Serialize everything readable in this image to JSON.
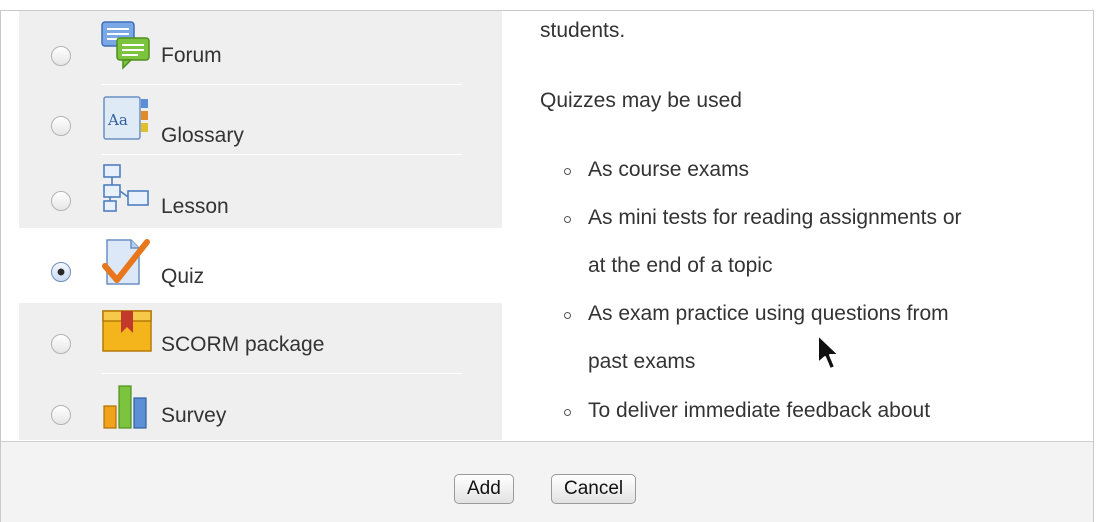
{
  "activities": [
    {
      "label": "Forum",
      "icon": "forum-icon",
      "selected": false
    },
    {
      "label": "Glossary",
      "icon": "glossary-icon",
      "selected": false
    },
    {
      "label": "Lesson",
      "icon": "lesson-icon",
      "selected": false
    },
    {
      "label": "Quiz",
      "icon": "quiz-icon",
      "selected": true
    },
    {
      "label": "SCORM package",
      "icon": "scorm-package-icon",
      "selected": false
    },
    {
      "label": "Survey",
      "icon": "survey-icon",
      "selected": false
    }
  ],
  "description": {
    "top_fragment": "students.",
    "intro": "Quizzes may be used",
    "bullets": [
      [
        "As course exams"
      ],
      [
        "As mini tests for reading assignments or",
        "at the end of a topic"
      ],
      [
        "As exam practice using questions from",
        "past exams"
      ],
      [
        "To deliver immediate feedback about"
      ]
    ]
  },
  "footer": {
    "add_label": "Add",
    "cancel_label": "Cancel"
  },
  "colors": {
    "list_background": "#efefef",
    "selected_row": "#ffffff",
    "footer_background": "#f3f3f3"
  }
}
